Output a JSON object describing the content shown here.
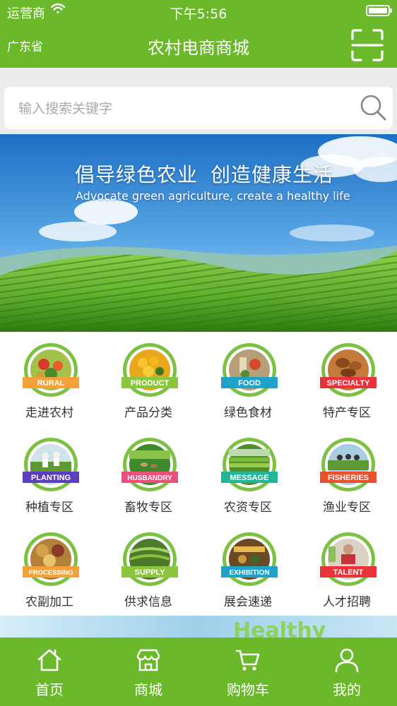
{
  "status_bar": {
    "carrier": "运营商",
    "time": "下午5:56"
  },
  "header": {
    "location": "广东省",
    "title": "农村电商商城",
    "scan_icon": "scan-icon"
  },
  "search": {
    "placeholder": "输入搜索关键字",
    "icon": "search-icon"
  },
  "banner": {
    "headline_part1": "倡导绿色农业",
    "headline_part2": "创造健康生活",
    "subline": "Advocate green agriculture, create a healthy life"
  },
  "categories": [
    {
      "label": "走进农村",
      "ribbon": "RURAL",
      "ribbon_color": "#f4a13a"
    },
    {
      "label": "产品分类",
      "ribbon": "PRODUCT",
      "ribbon_color": "#8cc63f"
    },
    {
      "label": "绿色食材",
      "ribbon": "FOOD",
      "ribbon_color": "#1fa2c7"
    },
    {
      "label": "特产专区",
      "ribbon": "SPECIALTY",
      "ribbon_color": "#e8323c"
    },
    {
      "label": "种植专区",
      "ribbon": "PLANTING",
      "ribbon_color": "#5b3fbf"
    },
    {
      "label": "畜牧专区",
      "ribbon": "HUSBANDRY",
      "ribbon_color": "#e8507e"
    },
    {
      "label": "农资专区",
      "ribbon": "MESSAGE",
      "ribbon_color": "#22b59a"
    },
    {
      "label": "渔业专区",
      "ribbon": "FISHERIES",
      "ribbon_color": "#e8502e"
    },
    {
      "label": "农副加工",
      "ribbon": "PROCESSING",
      "ribbon_color": "#f4a13a"
    },
    {
      "label": "供求信息",
      "ribbon": "SUPPLY",
      "ribbon_color": "#8cc63f"
    },
    {
      "label": "展会速递",
      "ribbon": "EXHIBITION",
      "ribbon_color": "#1fa2c7"
    },
    {
      "label": "人才招聘",
      "ribbon": "TALENT",
      "ribbon_color": "#e8323c"
    }
  ],
  "promo": {
    "text": "Healthy"
  },
  "tabbar": [
    {
      "label": "首页",
      "icon": "home-icon"
    },
    {
      "label": "商城",
      "icon": "store-icon"
    },
    {
      "label": "购物车",
      "icon": "cart-icon"
    },
    {
      "label": "我的",
      "icon": "user-icon"
    }
  ],
  "colors": {
    "brand_green": "#6bb82a",
    "ring_green": "#7cc242",
    "text": "#333333"
  }
}
